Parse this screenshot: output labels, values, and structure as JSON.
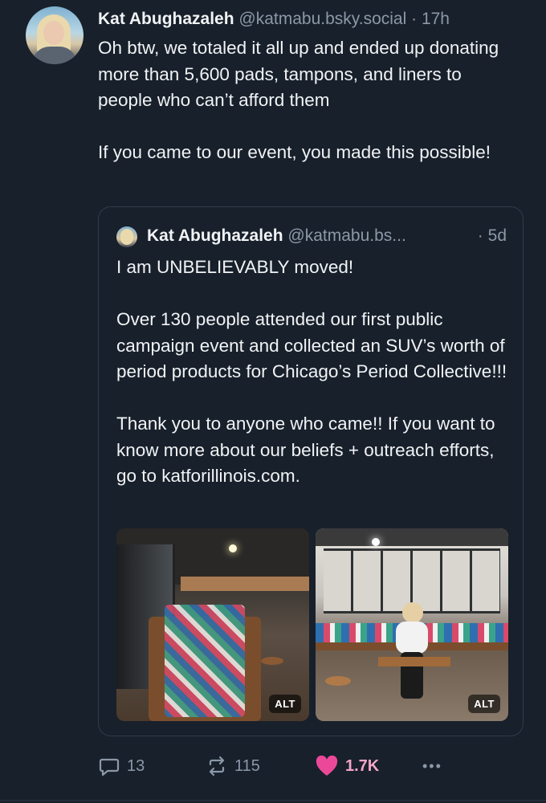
{
  "post": {
    "author_name": "Kat Abughazaleh",
    "author_handle": "@katmabu.bsky.social",
    "separator": "·",
    "time": "17h",
    "text": "Oh btw, we totaled it all up and ended up donating more than 5,600 pads, tampons, and liners to people who can’t afford them\n\nIf you came to our event, you made this possible!"
  },
  "quote": {
    "author_name": "Kat Abughazaleh",
    "author_handle": "@katmabu.bs...",
    "separator": "·",
    "time": "5d",
    "text": "I am UNBELIEVABLY moved!\n\nOver 130 people attended our first public campaign event and collected an SUV’s worth of period products for Chicago’s Period Collective!!!\n\nThank you to anyone who came!! If you want to know more about our beliefs + outreach efforts, go to katforillinois.com.",
    "images": [
      {
        "alt_badge": "ALT"
      },
      {
        "alt_badge": "ALT"
      }
    ]
  },
  "actions": {
    "replies": "13",
    "reposts": "115",
    "likes": "1.7K",
    "more": "•••",
    "like_color": "#ec4899"
  },
  "icons": [
    "reply-icon",
    "repost-icon",
    "heart-icon",
    "more-icon"
  ]
}
